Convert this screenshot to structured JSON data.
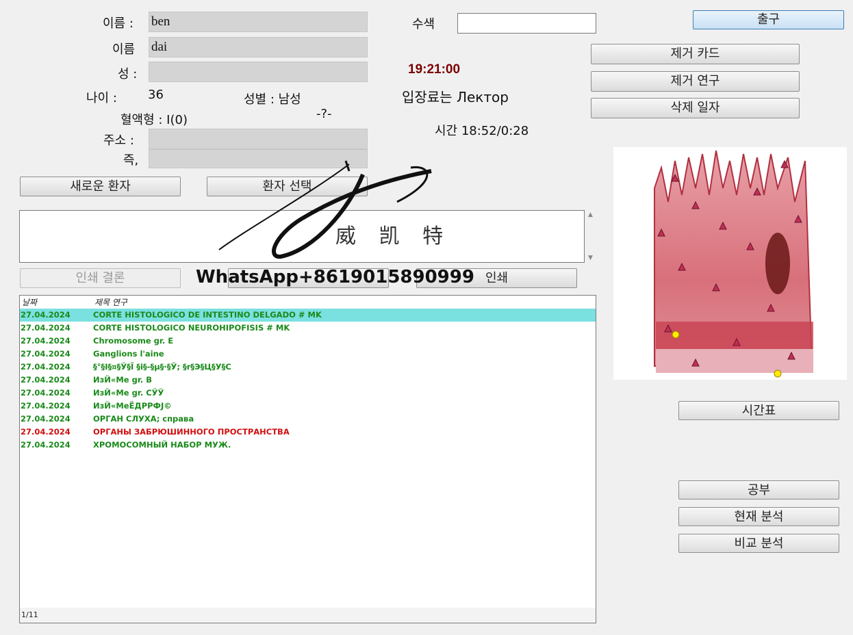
{
  "patient": {
    "first_name_label": "이름 :",
    "first_name_value": "ben",
    "second_name_label": "이름",
    "second_name_value": "dai",
    "surname_label": "성 :",
    "surname_value": "",
    "age_label": "나이 :",
    "age_value": "36",
    "gender_label": "성별 : 남성",
    "blood_label": "혈액형 : I(0)",
    "rh_value": "-?-",
    "address_label": "주소 :",
    "address_value": "",
    "address2_label": "즉,",
    "address2_value": ""
  },
  "search": {
    "label": "수색",
    "value": ""
  },
  "clock": {
    "time": "19:21:00",
    "time_color": "#7a0000",
    "entrance": "입장료는 Лектор",
    "session": "시간 18:52/0:28"
  },
  "buttons": {
    "exit": "출구",
    "remove_card": "제거 카드",
    "remove_study": "제거 연구",
    "delete_date": "삭제 일자",
    "new_patient": "새로운 환자",
    "select_patient": "환자 선택",
    "print_conclusion": "인쇄 결론",
    "middle_button": "",
    "print": "인쇄",
    "schedule": "시간표",
    "study": "공부",
    "current_analysis": "현재 분석",
    "compare_analysis": "비교 분석"
  },
  "list": {
    "col_date": "날짜",
    "col_title": "제목 연구",
    "rows": [
      {
        "date": "27.04.2024",
        "title": "CORTE HISTOLOGICO DE INTESTINO DELGADO # MK",
        "color": "#1a8a1a",
        "selected": true
      },
      {
        "date": "27.04.2024",
        "title": "CORTE HISTOLOGICO NEUROHIPOFISIS # MK",
        "color": "#1a8a1a",
        "selected": false
      },
      {
        "date": "27.04.2024",
        "title": "Chromosome gr. E",
        "color": "#1a8a1a",
        "selected": false
      },
      {
        "date": "27.04.2024",
        "title": "Ganglions l'aine",
        "color": "#1a8a1a",
        "selected": false
      },
      {
        "date": "27.04.2024",
        "title": "§°§І§¤§Ў§Ї  §і§-§µ§·§Ў;  §r§Э§Ц§У§С",
        "color": "#1a8a1a",
        "selected": false
      },
      {
        "date": "27.04.2024",
        "title": "ИзЙ«Ме gr. В",
        "color": "#1a8a1a",
        "selected": false
      },
      {
        "date": "27.04.2024",
        "title": "ИзЙ«Ме gr. СЎЎ",
        "color": "#1a8a1a",
        "selected": false
      },
      {
        "date": "27.04.2024",
        "title": "ИзЙ«МеЁДРРФЈ©",
        "color": "#1a8a1a",
        "selected": false
      },
      {
        "date": "27.04.2024",
        "title": "ОРГАН  СЛУХА;  справа",
        "color": "#1a8a1a",
        "selected": false
      },
      {
        "date": "27.04.2024",
        "title": "ОРГАНЫ ЗАБРЮШИННОГО ПРОСТРАНСТВА",
        "color": "#d01010",
        "selected": false
      },
      {
        "date": "27.04.2024",
        "title": "ХРОМОСОМНЫЙ  НАБОР  МУЖ.",
        "color": "#1a8a1a",
        "selected": false
      }
    ],
    "pager": "1/11"
  },
  "watermark": {
    "chinese": "威 凯 特",
    "whatsapp": "WhatsApp+8619015890999"
  }
}
